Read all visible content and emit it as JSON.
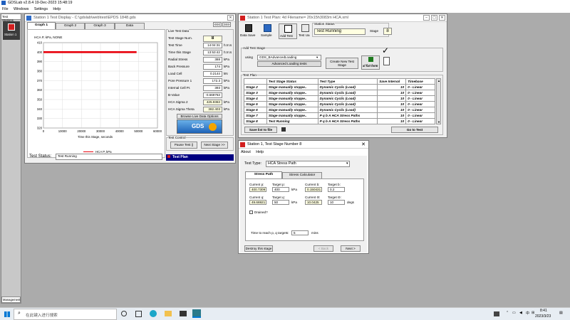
{
  "app": {
    "title": "GDSLab v2.8.4 19-Dec-2023 15:48:19",
    "menu": [
      "File",
      "Windows",
      "Settings",
      "Help"
    ]
  },
  "left_panel": {
    "header": "Test Stations",
    "station_label": "Station 1",
    "management": "Management"
  },
  "display_window": {
    "title": "Station 1 Test Display - C:\\gdslab\\web\\test\\EPDS 1848.gds",
    "nav": [
      "<<<",
      ">>>"
    ],
    "tabs": [
      "Graph 1",
      "Graph 2",
      "Graph 3",
      "Data"
    ],
    "graph_title": "HCA P, kPa, NONE",
    "x_axis_label": "Time this Stage, seconds",
    "legend": "HCA P, kPa",
    "status_label": "Test Status:",
    "status_value": "Test Running",
    "live_data": {
      "header": "Live Test Data",
      "rows": [
        {
          "label": "Test Stage Num.",
          "value": "8",
          "unit": ""
        },
        {
          "label": "Test Time",
          "value": "14:04:31",
          "unit": "h:m:s"
        },
        {
          "label": "Time this Stage",
          "value": "13:53:42",
          "unit": "h:m:s"
        },
        {
          "label": "Radial Stress",
          "value": "388",
          "unit": "kPa"
        },
        {
          "label": "Back Pressure",
          "value": "174",
          "unit": "kPa"
        },
        {
          "label": "Load Cell",
          "value": "0.2144",
          "unit": "kN"
        },
        {
          "label": "Pore Pressure 1",
          "value": "172.3",
          "unit": "kPa"
        },
        {
          "label": "Internal Cell Pr.",
          "value": "393",
          "unit": "kPa"
        },
        {
          "label": "B-Value",
          "value": "-0.669763",
          "unit": ""
        },
        {
          "label": "HCA Sigma 2",
          "value": "425.9363",
          "unit": "kPa"
        },
        {
          "label": "HCA Sigma Theta",
          "value": "382.403",
          "unit": "kPa"
        }
      ],
      "browse_button": "Browse Live Data Options",
      "logo_text": "GDS"
    },
    "test_control": {
      "header": "Test Control",
      "pause": "Pause Test ||",
      "next": "Next Stage >>"
    },
    "test_plan_bar": "Test Plan"
  },
  "test_plan_window": {
    "title": "Station 1 Test Plan: 4d Filename= 20x15h3083m HCA.xml",
    "toolbar": [
      "Data Save",
      "Sample",
      "Add Test",
      "Test Ua"
    ],
    "station_status_header": "Station Status",
    "station_status_value": "Test Running",
    "stage_label": "Stage",
    "stage_value": "8",
    "add_stage_header": "Add Test Stage",
    "using_label": "using",
    "using_value": "GDS_BAdvancedLoading",
    "advanced_label": "Advanced Loading tests",
    "create_button": "Create New Test Stage",
    "xl_button": "xl fixt form",
    "plan_header": "Test Plan",
    "columns": [
      "",
      "Test Stage Status",
      "Test Type",
      "Save Interval",
      "Timebase"
    ],
    "rows": [
      [
        "Stage 2",
        "Stage manually stoppe..",
        "Dynamic Cyclic (Load)",
        "10",
        "0 - Linear"
      ],
      [
        "Stage 3",
        "Stage manually stoppe..",
        "Dynamic Cyclic (Load)",
        "10",
        "0 - Linear"
      ],
      [
        "Stage 4",
        "Stage manually stoppe..",
        "Dynamic Cyclic (Load)",
        "10",
        "0 - Linear"
      ],
      [
        "Stage 5",
        "Stage manually stoppe..",
        "Dynamic Cyclic (Load)",
        "10",
        "0 - Linear"
      ],
      [
        "Stage 6",
        "Stage manually stoppe..",
        "Dynamic Cyclic (Load)",
        "10",
        "0 - Linear"
      ],
      [
        "Stage 7",
        "Stage manually stoppe..",
        "P q b A HCA Stress Paths",
        "10",
        "0 - Linear"
      ],
      [
        "Stage 8",
        "Test Running",
        "P q b A HCA Stress Paths",
        "10",
        "0 - Linear"
      ]
    ],
    "save_list": "Save list to file",
    "goto_test": "Go to Test"
  },
  "stage_dialog": {
    "title": "Station 1, Test Stage Number 8",
    "menu": [
      "About",
      "Help"
    ],
    "test_type_label": "Test Type:",
    "test_type_value": "HCA Stress Path",
    "tabs": [
      "Stress Path",
      "Stress Calculator"
    ],
    "fields": [
      {
        "label": "Current p:",
        "value": "400.7309"
      },
      {
        "label": "Target p:",
        "value": "400",
        "unit": "kPa"
      },
      {
        "label": "Current b:",
        "value": "0.150431"
      },
      {
        "label": "Target b:",
        "value": "0.2"
      },
      {
        "label": "Current q:",
        "value": "49.66921"
      },
      {
        "label": "Target q:",
        "value": "50",
        "unit": "kPa"
      },
      {
        "label": "Current Θ:",
        "value": "10.0425"
      },
      {
        "label": "Target Θ:",
        "value": "10",
        "unit": "degs"
      }
    ],
    "drained_label": "Drained?",
    "time_label": "Time to reach p, q targets:",
    "time_value": "5",
    "time_unit": "mins",
    "destroy": "Destroy this stage",
    "back": "< Back",
    "next": "Next >"
  },
  "taskbar": {
    "search_placeholder": "在此键入进行搜索",
    "time": "8:41",
    "date": "2023/3/23",
    "lang": "中"
  },
  "chart_data": {
    "type": "line",
    "title": "HCA P, kPa, NONE",
    "xlabel": "Time this Stage, seconds",
    "ylabel": "",
    "xlim": [
      0,
      60000
    ],
    "ylim": [
      320,
      410
    ],
    "xticks": [
      0,
      10000,
      20000,
      30000,
      40000,
      50000,
      60000
    ],
    "yticks": [
      320,
      330,
      340,
      350,
      360,
      370,
      380,
      390,
      400,
      410
    ],
    "series": [
      {
        "name": "HCA P, kPa",
        "color": "#e8000b",
        "x": [
          0,
          49000
        ],
        "y": [
          400,
          400
        ]
      }
    ],
    "grid": true
  }
}
